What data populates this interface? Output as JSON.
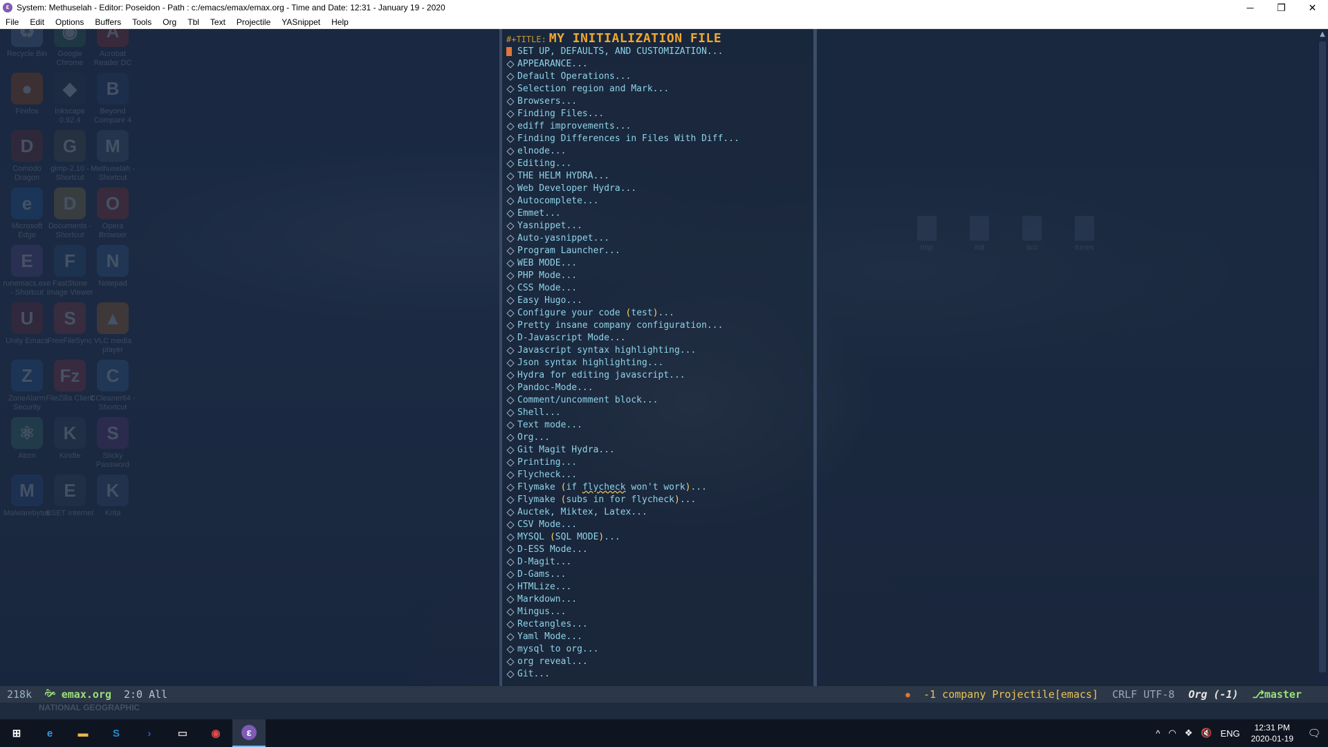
{
  "window": {
    "title": "System: Methuselah - Editor: Poseidon - Path : c:/emacs/emax/emax.org - Time and Date: 12:31 - January 19 - 2020",
    "app_icon": "emacs-icon",
    "minimize": "─",
    "maximize": "❐",
    "close": "✕"
  },
  "menubar": [
    "File",
    "Edit",
    "Options",
    "Buffers",
    "Tools",
    "Org",
    "Tbl",
    "Text",
    "Projectile",
    "YASnippet",
    "Help"
  ],
  "desktop": {
    "icons": [
      {
        "label": "Recycle Bin",
        "glyph": "♻",
        "color": "#6b8cb8"
      },
      {
        "label": "Google Chrome",
        "glyph": "◉",
        "color": "#3c7a50"
      },
      {
        "label": "Acrobat Reader DC",
        "glyph": "A",
        "color": "#c0392b"
      },
      {
        "label": "Firefox",
        "glyph": "●",
        "color": "#d35400"
      },
      {
        "label": "Inkscape 0.92.4",
        "glyph": "◆",
        "color": "#2c3e50"
      },
      {
        "label": "Beyond Compare 4",
        "glyph": "B",
        "color": "#2c4f7c"
      },
      {
        "label": "Comodo Dragon",
        "glyph": "D",
        "color": "#8e2b2b"
      },
      {
        "label": "gimp-2.10 - Shortcut",
        "glyph": "G",
        "color": "#5a5a4a"
      },
      {
        "label": "Methuselah - Shortcut",
        "glyph": "M",
        "color": "#556b85"
      },
      {
        "label": "Microsoft Edge",
        "glyph": "e",
        "color": "#1e6fb8"
      },
      {
        "label": "Documents - Shortcut",
        "glyph": "D",
        "color": "#b8973c"
      },
      {
        "label": "Opera Browser",
        "glyph": "O",
        "color": "#c0392b"
      },
      {
        "label": "runemacs.exe - Shortcut",
        "glyph": "E",
        "color": "#6b4fa0"
      },
      {
        "label": "FastStone Image Viewer",
        "glyph": "F",
        "color": "#2e5f8a"
      },
      {
        "label": "Notepad",
        "glyph": "N",
        "color": "#3d6ea8"
      },
      {
        "label": "Unity Emacs",
        "glyph": "U",
        "color": "#8e2b2b"
      },
      {
        "label": "FreeFileSync",
        "glyph": "S",
        "color": "#b83c3c"
      },
      {
        "label": "VLC media player",
        "glyph": "▲",
        "color": "#d67d1e"
      },
      {
        "label": "ZoneAlarm Security",
        "glyph": "Z",
        "color": "#2c6fb8"
      },
      {
        "label": "FileZilla Client",
        "glyph": "Fz",
        "color": "#b83c3c"
      },
      {
        "label": "CCleaner64 - Shortcut",
        "glyph": "C",
        "color": "#3c78b8"
      },
      {
        "label": "Atom",
        "glyph": "⚛",
        "color": "#4a8f7a"
      },
      {
        "label": "Kindle",
        "glyph": "K",
        "color": "#3d4f66"
      },
      {
        "label": "Sticky Password",
        "glyph": "S",
        "color": "#7a3c8e"
      },
      {
        "label": "Malwarebytes",
        "glyph": "M",
        "color": "#2c5fa8"
      },
      {
        "label": "ESET Internet",
        "glyph": "E",
        "color": "#3d4f66"
      },
      {
        "label": "Krita",
        "glyph": "K",
        "color": "#4a5f8e"
      }
    ],
    "folders": [
      "tmp",
      "init",
      "scc",
      "tunes"
    ]
  },
  "editor": {
    "title_keyword": "#+TITLE:",
    "title_value": "MY INITIALIZATION FILE",
    "headings": [
      "SET UP, DEFAULTS, AND CUSTOMIZATION...",
      "APPEARANCE...",
      "Default Operations...",
      "Selection region and Mark...",
      "Browsers...",
      "Finding Files...",
      "ediff improvements...",
      "Finding Differences in Files With Diff...",
      "elnode...",
      "Editing...",
      "THE HELM HYDRA...",
      "Web Developer Hydra...",
      "Autocomplete...",
      "Emmet...",
      "Yasnippet...",
      "Auto-yasnippet...",
      "Program Launcher...",
      "WEB MODE...",
      "PHP Mode...",
      "CSS Mode...",
      "Easy Hugo...",
      "Configure your code (test)...",
      "Pretty insane company configuration...",
      "D-Javascript Mode...",
      "Javascript syntax highlighting...",
      "Json syntax highlighting...",
      "Hydra for editing javascript...",
      "Pandoc-Mode...",
      "Comment/uncomment block...",
      "Shell...",
      "Text mode...",
      "Org...",
      "Git Magit Hydra...",
      "Printing...",
      "Flycheck...",
      "Flymake (if flycheck won't work)...",
      "Flymake (subs in for flycheck)...",
      "Auctek, Miktex, Latex...",
      "CSV Mode...",
      "MYSQL (SQL MODE)...",
      "D-ESS Mode...",
      "D-Magit...",
      "D-Gams...",
      "HTMLize...",
      "Markdown...",
      "Mingus...",
      "Rectangles...",
      "Yaml Mode...",
      "mysql to org...",
      "org reveal...",
      "Git..."
    ]
  },
  "modeline": {
    "size": "218k",
    "file_icon": "emacs-leaf-icon",
    "buffer": "emax.org",
    "position": "2:0 All",
    "bug_icon": "bug-icon",
    "minor_modes": "-1 company Projectile[emacs]",
    "encoding": "CRLF UTF-8",
    "major_mode": "Org (-1)",
    "git_branch": "master"
  },
  "echo_watermark": "NATIONAL GEOGRAPHIC",
  "taskbar": {
    "apps": [
      {
        "name": "windows-start-icon",
        "glyph": "⊞",
        "color": "#ffffff"
      },
      {
        "name": "edge-icon",
        "glyph": "e",
        "color": "#3a96dd"
      },
      {
        "name": "file-explorer-icon",
        "glyph": "▬",
        "color": "#e8b84a"
      },
      {
        "name": "skype-icon",
        "glyph": "S",
        "color": "#1e8fd8"
      },
      {
        "name": "powershell-icon",
        "glyph": "›",
        "color": "#2a5eb8"
      },
      {
        "name": "terminal-icon",
        "glyph": "▭",
        "color": "#cccccc"
      },
      {
        "name": "media-icon",
        "glyph": "◉",
        "color": "#e04a4a"
      },
      {
        "name": "emacs-icon",
        "glyph": "ε",
        "color": "#7e5bb5"
      }
    ],
    "tray": {
      "chevron": "^",
      "network_icon": "wifi-icon",
      "dropbox_icon": "dropbox-icon",
      "volume_icon": "mute-icon",
      "lang": "ENG",
      "time": "12:31 PM",
      "date": "2020-01-19",
      "notification_icon": "notification-icon"
    }
  }
}
